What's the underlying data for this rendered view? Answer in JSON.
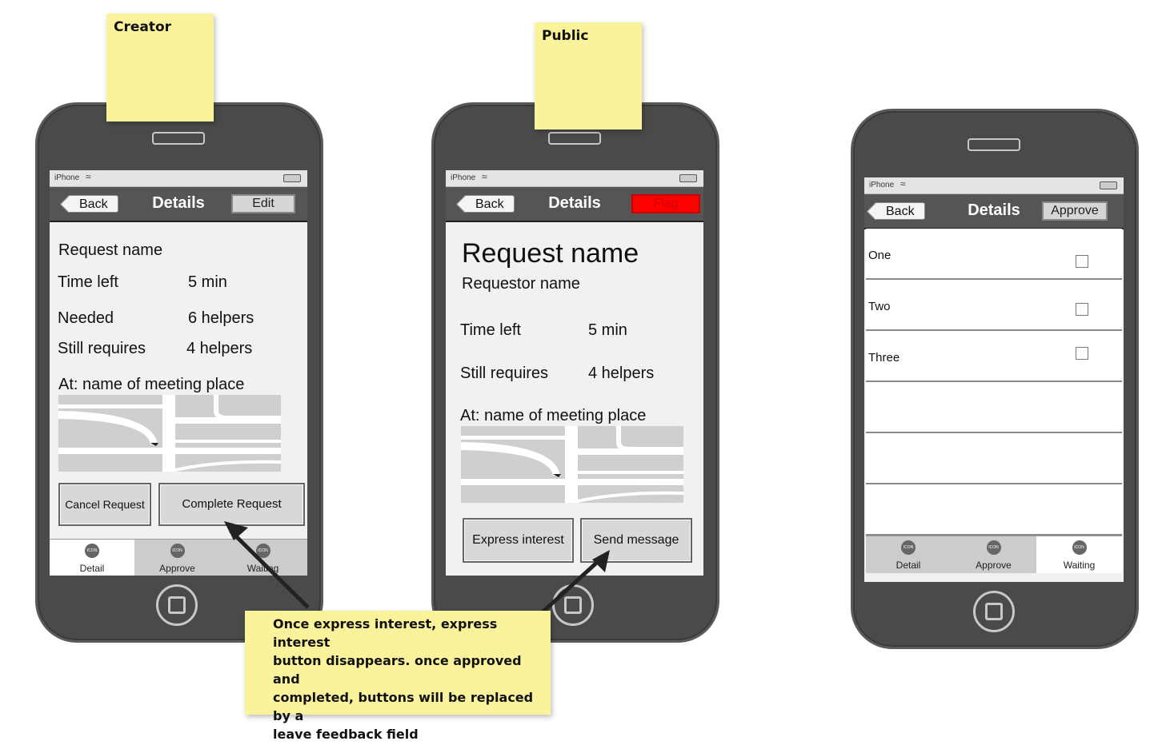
{
  "phone1": {
    "status": {
      "carrier": "iPhone"
    },
    "navbar": {
      "back": "Back",
      "title": "Details",
      "right": "Edit"
    },
    "content": {
      "request_name": "Request name",
      "time_left_label": "Time left",
      "time_left_value": "5 min",
      "needed_label": "Needed",
      "needed_value": "6 helpers",
      "still_requires_label": "Still requires",
      "still_requires_value": "4 helpers",
      "meeting_place": "At: name of meeting place"
    },
    "buttons": {
      "cancel": "Cancel Request",
      "complete": "Complete Request"
    },
    "tabs": [
      {
        "icon": "ICON",
        "label": "Detail"
      },
      {
        "icon": "ICON",
        "label": "Approve"
      },
      {
        "icon": "ICON",
        "label": "Waiting"
      }
    ]
  },
  "phone2": {
    "status": {
      "carrier": "iPhone"
    },
    "navbar": {
      "back": "Back",
      "title": "Details",
      "right": "Flag"
    },
    "content": {
      "request_name": "Request name",
      "requestor_name": "Requestor name",
      "time_left_label": "Time left",
      "time_left_value": "5 min",
      "still_requires_label": "Still requires",
      "still_requires_value": "4 helpers",
      "meeting_place": "At: name of meeting place"
    },
    "buttons": {
      "express": "Express interest",
      "send": "Send message"
    }
  },
  "phone3": {
    "status": {
      "carrier": "iPhone"
    },
    "navbar": {
      "back": "Back",
      "title": "Details",
      "right": "Approve"
    },
    "list": [
      {
        "label": "One"
      },
      {
        "label": "Two"
      },
      {
        "label": "Three"
      },
      {
        "label": ""
      },
      {
        "label": ""
      },
      {
        "label": ""
      }
    ],
    "tabs": [
      {
        "icon": "ICON",
        "label": "Detail"
      },
      {
        "icon": "ICON",
        "label": "Approve"
      },
      {
        "icon": "ICON",
        "label": "Waiting"
      }
    ]
  },
  "notes": {
    "creator": "Creator",
    "public": "Public",
    "annotation": [
      "Once express interest, express interest",
      "button disappears. once approved and",
      "completed, buttons will be replaced by a",
      "leave feedback field"
    ]
  },
  "colors": {
    "flag": "#ff0000",
    "sticky": "#fbf39b",
    "phone_body": "#4a4a4a"
  }
}
